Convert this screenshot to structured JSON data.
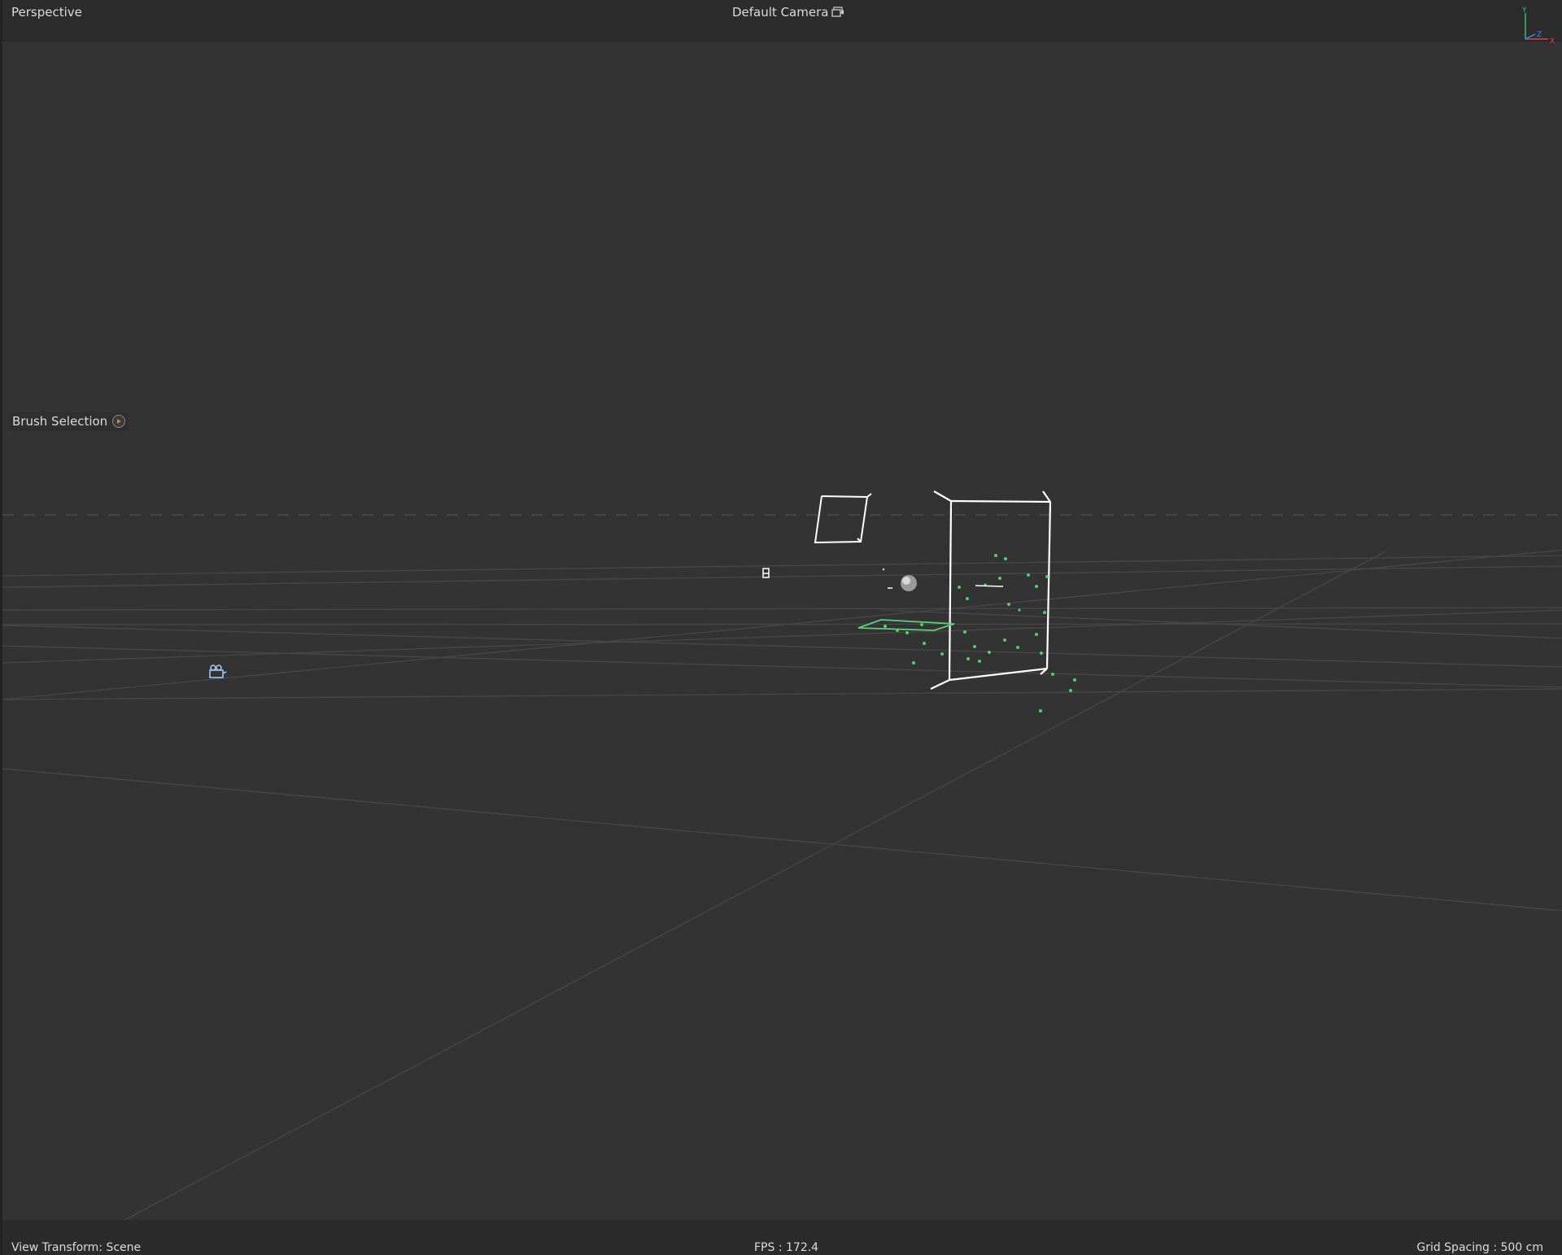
{
  "viewport": {
    "view_label": "Perspective",
    "camera_title": "Default Camera",
    "camera_icon": "camera-link-icon",
    "axis_labels": {
      "y": "Y",
      "z": "Z",
      "x": "X"
    },
    "axis_colors": {
      "y": "#37c05a",
      "z": "#3b86ff",
      "x": "#e0453c"
    }
  },
  "tool_panel": {
    "label": "Brush Selection",
    "toggle_icon": "play-circle-icon"
  },
  "footer": {
    "view_transform": "View Transform: Scene",
    "fps": "FPS : 172.4",
    "grid_spacing": "Grid Spacing : 500 cm"
  },
  "colors": {
    "background": "#333333",
    "grid_line": "#4a4a4a",
    "horizon_dash": "#4c4c4c",
    "selection_white": "#ffffff",
    "particle_green": "#4fd06b",
    "emitter_green": "#5fcf7a",
    "camera_blue": "#9fc7ef"
  }
}
